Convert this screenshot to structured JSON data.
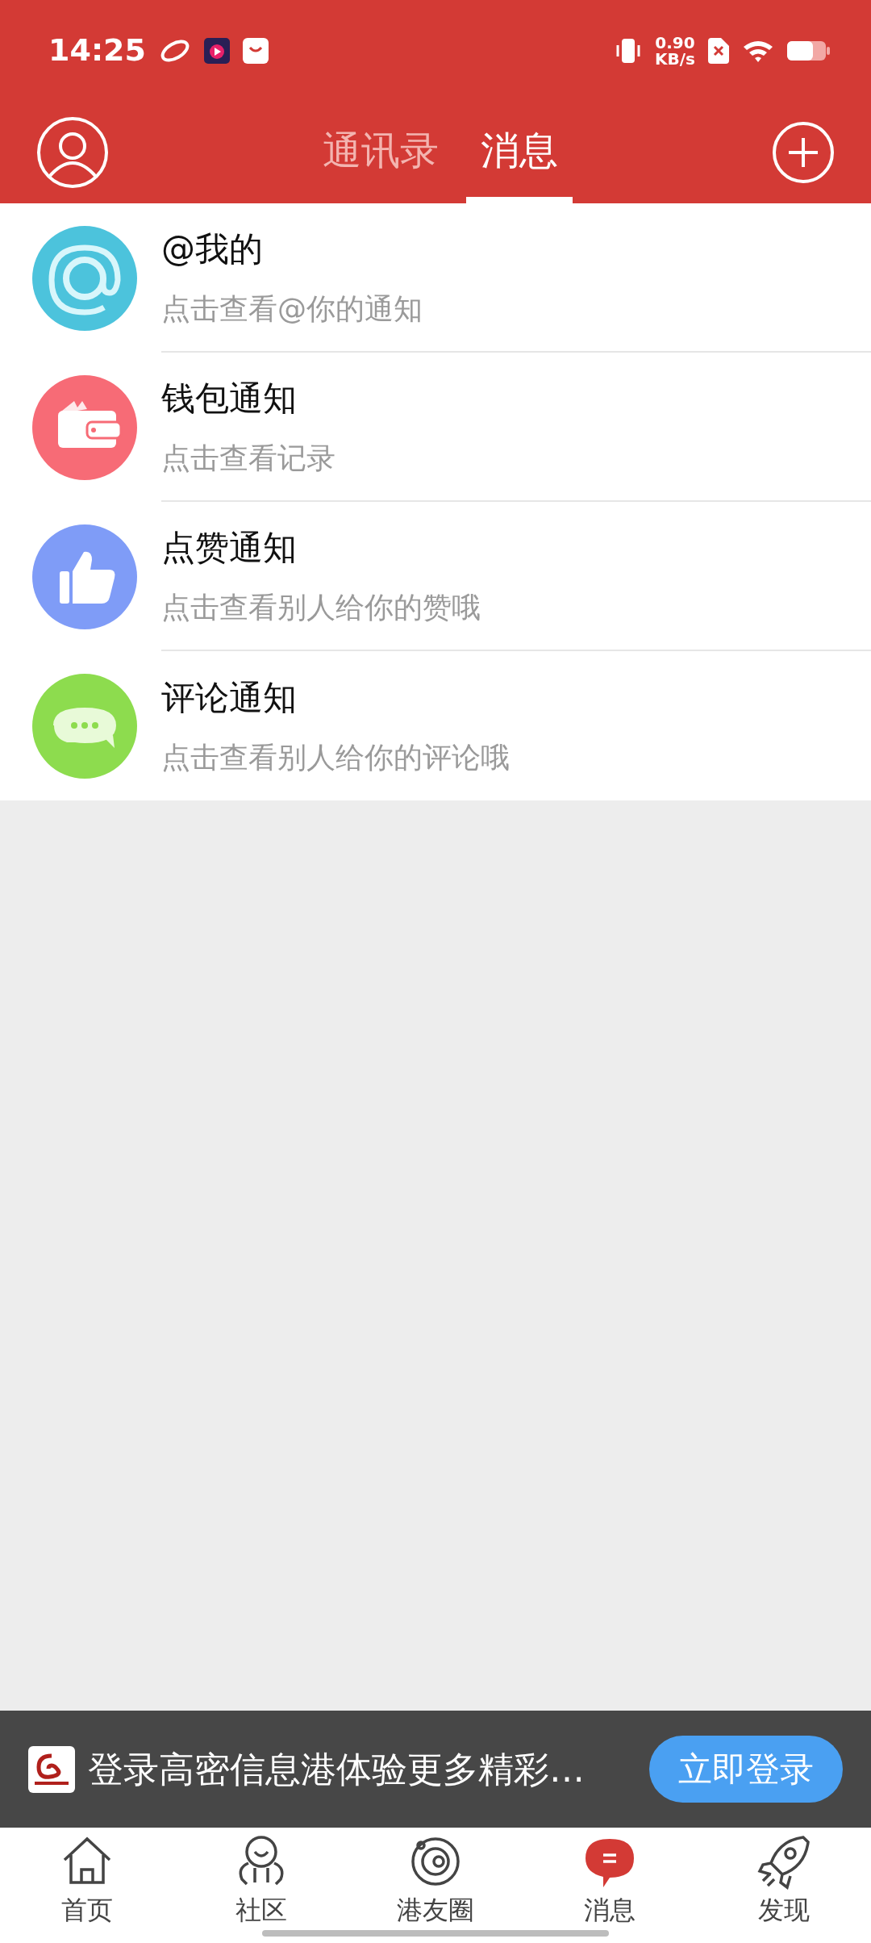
{
  "status_bar": {
    "time": "14:25",
    "network_speed": "0.90",
    "speed_unit": "KB/s"
  },
  "header": {
    "tabs": [
      {
        "label": "通讯录",
        "selected": false
      },
      {
        "label": "消息",
        "selected": true
      }
    ]
  },
  "notifications": [
    {
      "kind": "at",
      "color": "#4cc3dc",
      "title": "@我的",
      "subtitle": "点击查看@你的通知"
    },
    {
      "kind": "wallet",
      "color": "#f76b76",
      "title": "钱包通知",
      "subtitle": "点击查看记录"
    },
    {
      "kind": "like",
      "color": "#7f9cf7",
      "title": "点赞通知",
      "subtitle": "点击查看别人给你的赞哦"
    },
    {
      "kind": "comment",
      "color": "#8ddc4e",
      "title": "评论通知",
      "subtitle": "点击查看别人给你的评论哦"
    }
  ],
  "login_banner": {
    "text": "登录高密信息港体验更多精彩…",
    "button": "立即登录"
  },
  "bottom_nav": [
    {
      "kind": "home",
      "label": "首页",
      "selected": false
    },
    {
      "kind": "community",
      "label": "社区",
      "selected": false
    },
    {
      "kind": "circle",
      "label": "港友圈",
      "selected": false
    },
    {
      "kind": "message",
      "label": "消息",
      "selected": true
    },
    {
      "kind": "discover",
      "label": "发现",
      "selected": false
    }
  ]
}
